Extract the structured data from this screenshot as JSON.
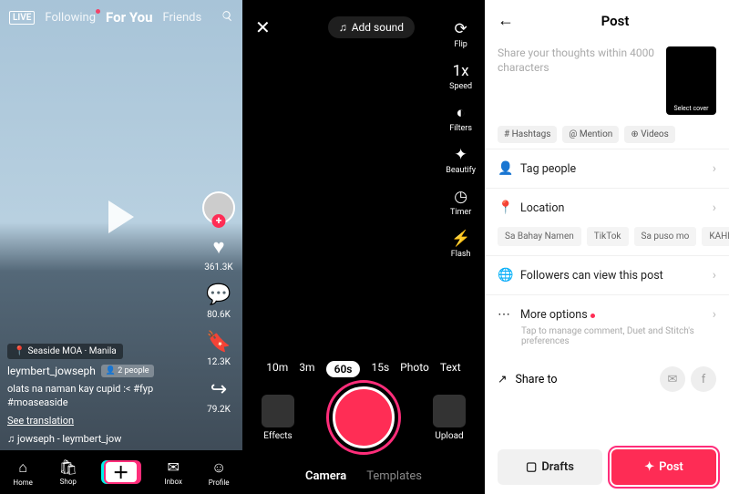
{
  "feed": {
    "tabs": {
      "following": "Following",
      "foryou": "For You",
      "friends": "Friends"
    },
    "live_badge": "LIVE",
    "location_pill": "Seaside MOA · Manila",
    "author": "leymbert_jowseph",
    "people_pill": "2 people",
    "caption": "olats na naman kay cupid :< #fyp #moaseaside",
    "see_translation": "See translation",
    "music": "♫ jowseph - leymbert_jow",
    "stats": {
      "likes": "361.3K",
      "comments": "80.6K",
      "saves": "12.3K",
      "shares": "79.2K"
    },
    "nav": {
      "home": "Home",
      "shop": "Shop",
      "inbox": "Inbox",
      "profile": "Profile"
    }
  },
  "camera": {
    "add_sound": "Add sound",
    "tools": {
      "flip": "Flip",
      "speed": "Speed",
      "filters": "Filters",
      "beautify": "Beautify",
      "timer": "Timer",
      "flash": "Flash"
    },
    "speed_badge": "1x",
    "durations": [
      "10m",
      "3m",
      "60s",
      "15s",
      "Photo",
      "Text"
    ],
    "active_duration": "60s",
    "effects": "Effects",
    "upload": "Upload",
    "tabs": {
      "camera": "Camera",
      "templates": "Templates"
    }
  },
  "post": {
    "title": "Post",
    "placeholder": "Share your thoughts within 4000 characters",
    "cover_label": "Select cover",
    "chips": {
      "hashtags": "# Hashtags",
      "mention": "@ Mention",
      "videos": "⊕ Videos"
    },
    "rows": {
      "tag": "Tag people",
      "location": "Location",
      "visibility": "Followers can view this post",
      "more": "More options"
    },
    "more_sub": "Tap to manage comment, Duet and Stitch's preferences",
    "location_suggestions": [
      "Sa Bahay Namen",
      "TikTok",
      "Sa puso mo",
      "KAHIT SA"
    ],
    "share_to": "Share to",
    "drafts": "Drafts",
    "post_btn": "Post"
  }
}
